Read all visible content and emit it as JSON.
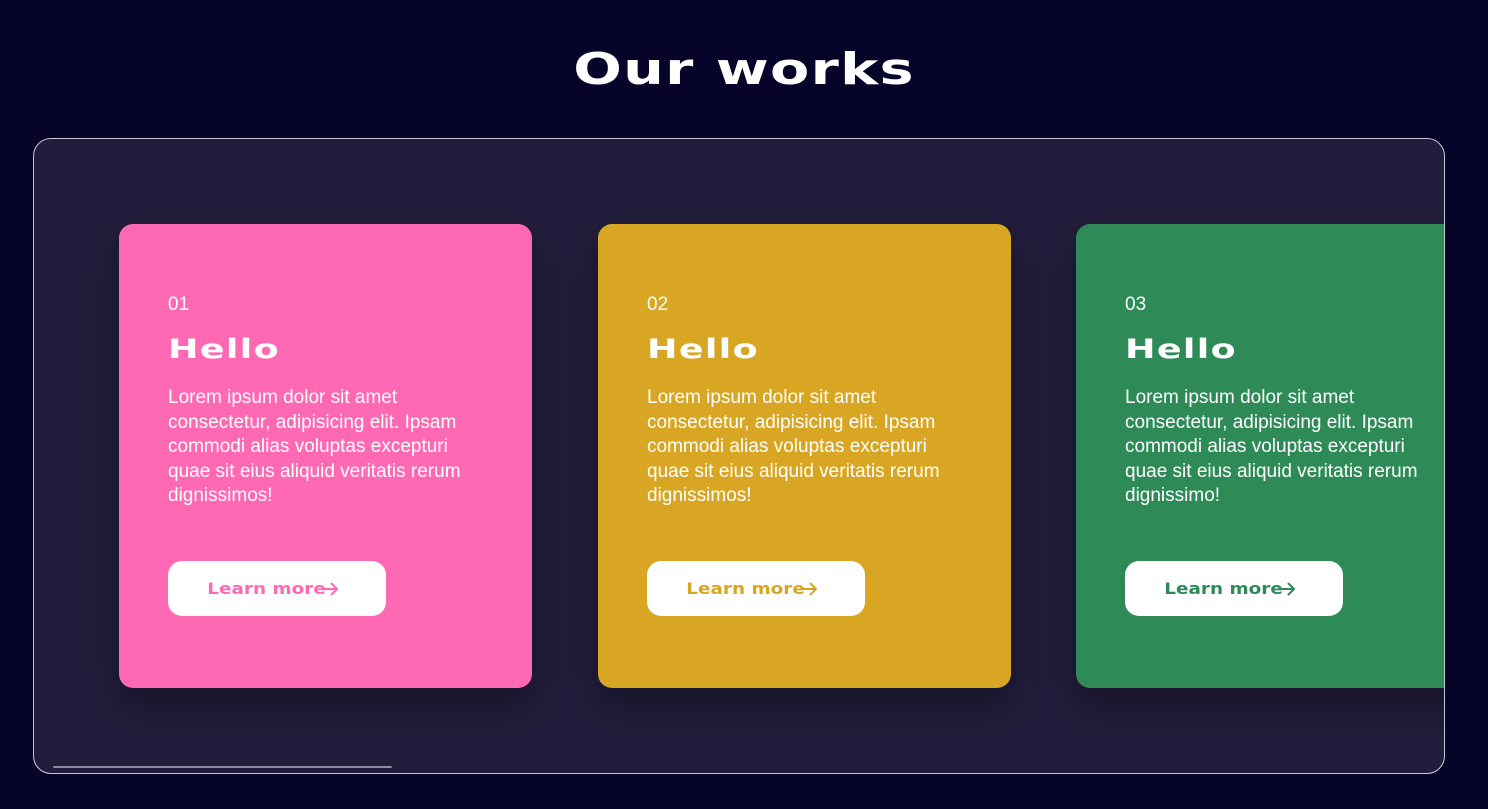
{
  "section": {
    "title": "Our works"
  },
  "cards": [
    {
      "number": "01",
      "title": "Hello",
      "text": "Lorem ipsum dolor sit amet consectetur, adipisicing elit. Ipsam commodi alias voluptas excepturi quae sit eius aliquid veritatis rerum dignissimos!",
      "button_label": "Learn more",
      "color": "#ff69b4"
    },
    {
      "number": "02",
      "title": "Hello",
      "text": "Lorem ipsum dolor sit amet consectetur, adipisicing elit. Ipsam commodi alias voluptas excepturi quae sit eius aliquid veritatis rerum dignissimos!",
      "button_label": "Learn more",
      "color": "#d8a622"
    },
    {
      "number": "03",
      "title": "Hello",
      "text": "Lorem ipsum dolor sit amet consectetur, adipisicing elit. Ipsam commodi alias voluptas excepturi quae sit eius aliquid veritatis rerum dignissimo!",
      "button_label": "Learn more",
      "color": "#2e8b57"
    }
  ],
  "theme": {
    "background": "#07042a",
    "frame_background": "#221d3c",
    "text": "#ffffff"
  }
}
